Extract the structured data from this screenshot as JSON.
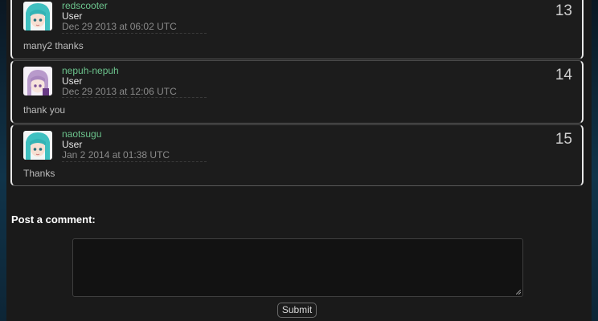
{
  "comments": [
    {
      "number": "13",
      "username": "redscooter",
      "role": "User",
      "date": "Dec 29 2013 at 06:02 UTC",
      "text": "many2 thanks",
      "avatar_icon": "cyan-hair-anime-avatar-icon"
    },
    {
      "number": "14",
      "username": "nepuh-nepuh",
      "role": "User",
      "date": "Dec 29 2013 at 12:06 UTC",
      "text": "thank you",
      "avatar_icon": "purple-hair-anime-avatar-icon"
    },
    {
      "number": "15",
      "username": "naotsugu",
      "role": "User",
      "date": "Jan 2 2014 at 01:38 UTC",
      "text": "Thanks",
      "avatar_icon": "cyan-hair-anime-avatar-icon"
    }
  ],
  "post_comment": {
    "title": "Post a comment:",
    "textarea_value": "",
    "submit_label": "Submit"
  },
  "colors": {
    "username": "#6cc48d",
    "background": "#1a1a1a",
    "border": "#e8e8e8"
  }
}
